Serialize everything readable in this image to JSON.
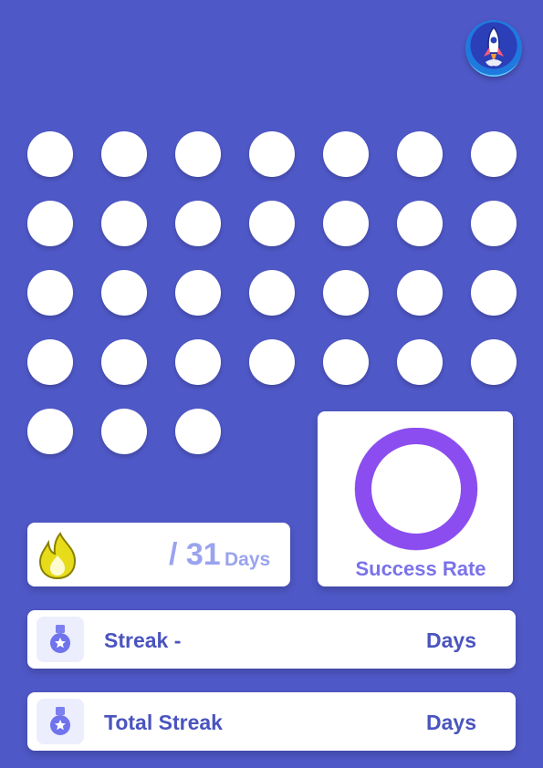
{
  "calendar": {
    "day_count": 31
  },
  "progress": {
    "total_text": "/ 31",
    "unit": "Days"
  },
  "success": {
    "label": "Success Rate"
  },
  "streak": {
    "label": "Streak -",
    "unit": "Days"
  },
  "total_streak": {
    "label": "Total Streak",
    "unit": "Days"
  },
  "colors": {
    "background": "#4f58c7",
    "ring": "#8b4cf0",
    "text_primary": "#4a54bf",
    "text_muted": "#9aa3ee",
    "flame": "#e6dc1a"
  },
  "icons": {
    "app_logo": "rocket-logo-icon",
    "progress": "flame-icon",
    "streak": "medal-icon",
    "total_streak": "medal-icon"
  }
}
